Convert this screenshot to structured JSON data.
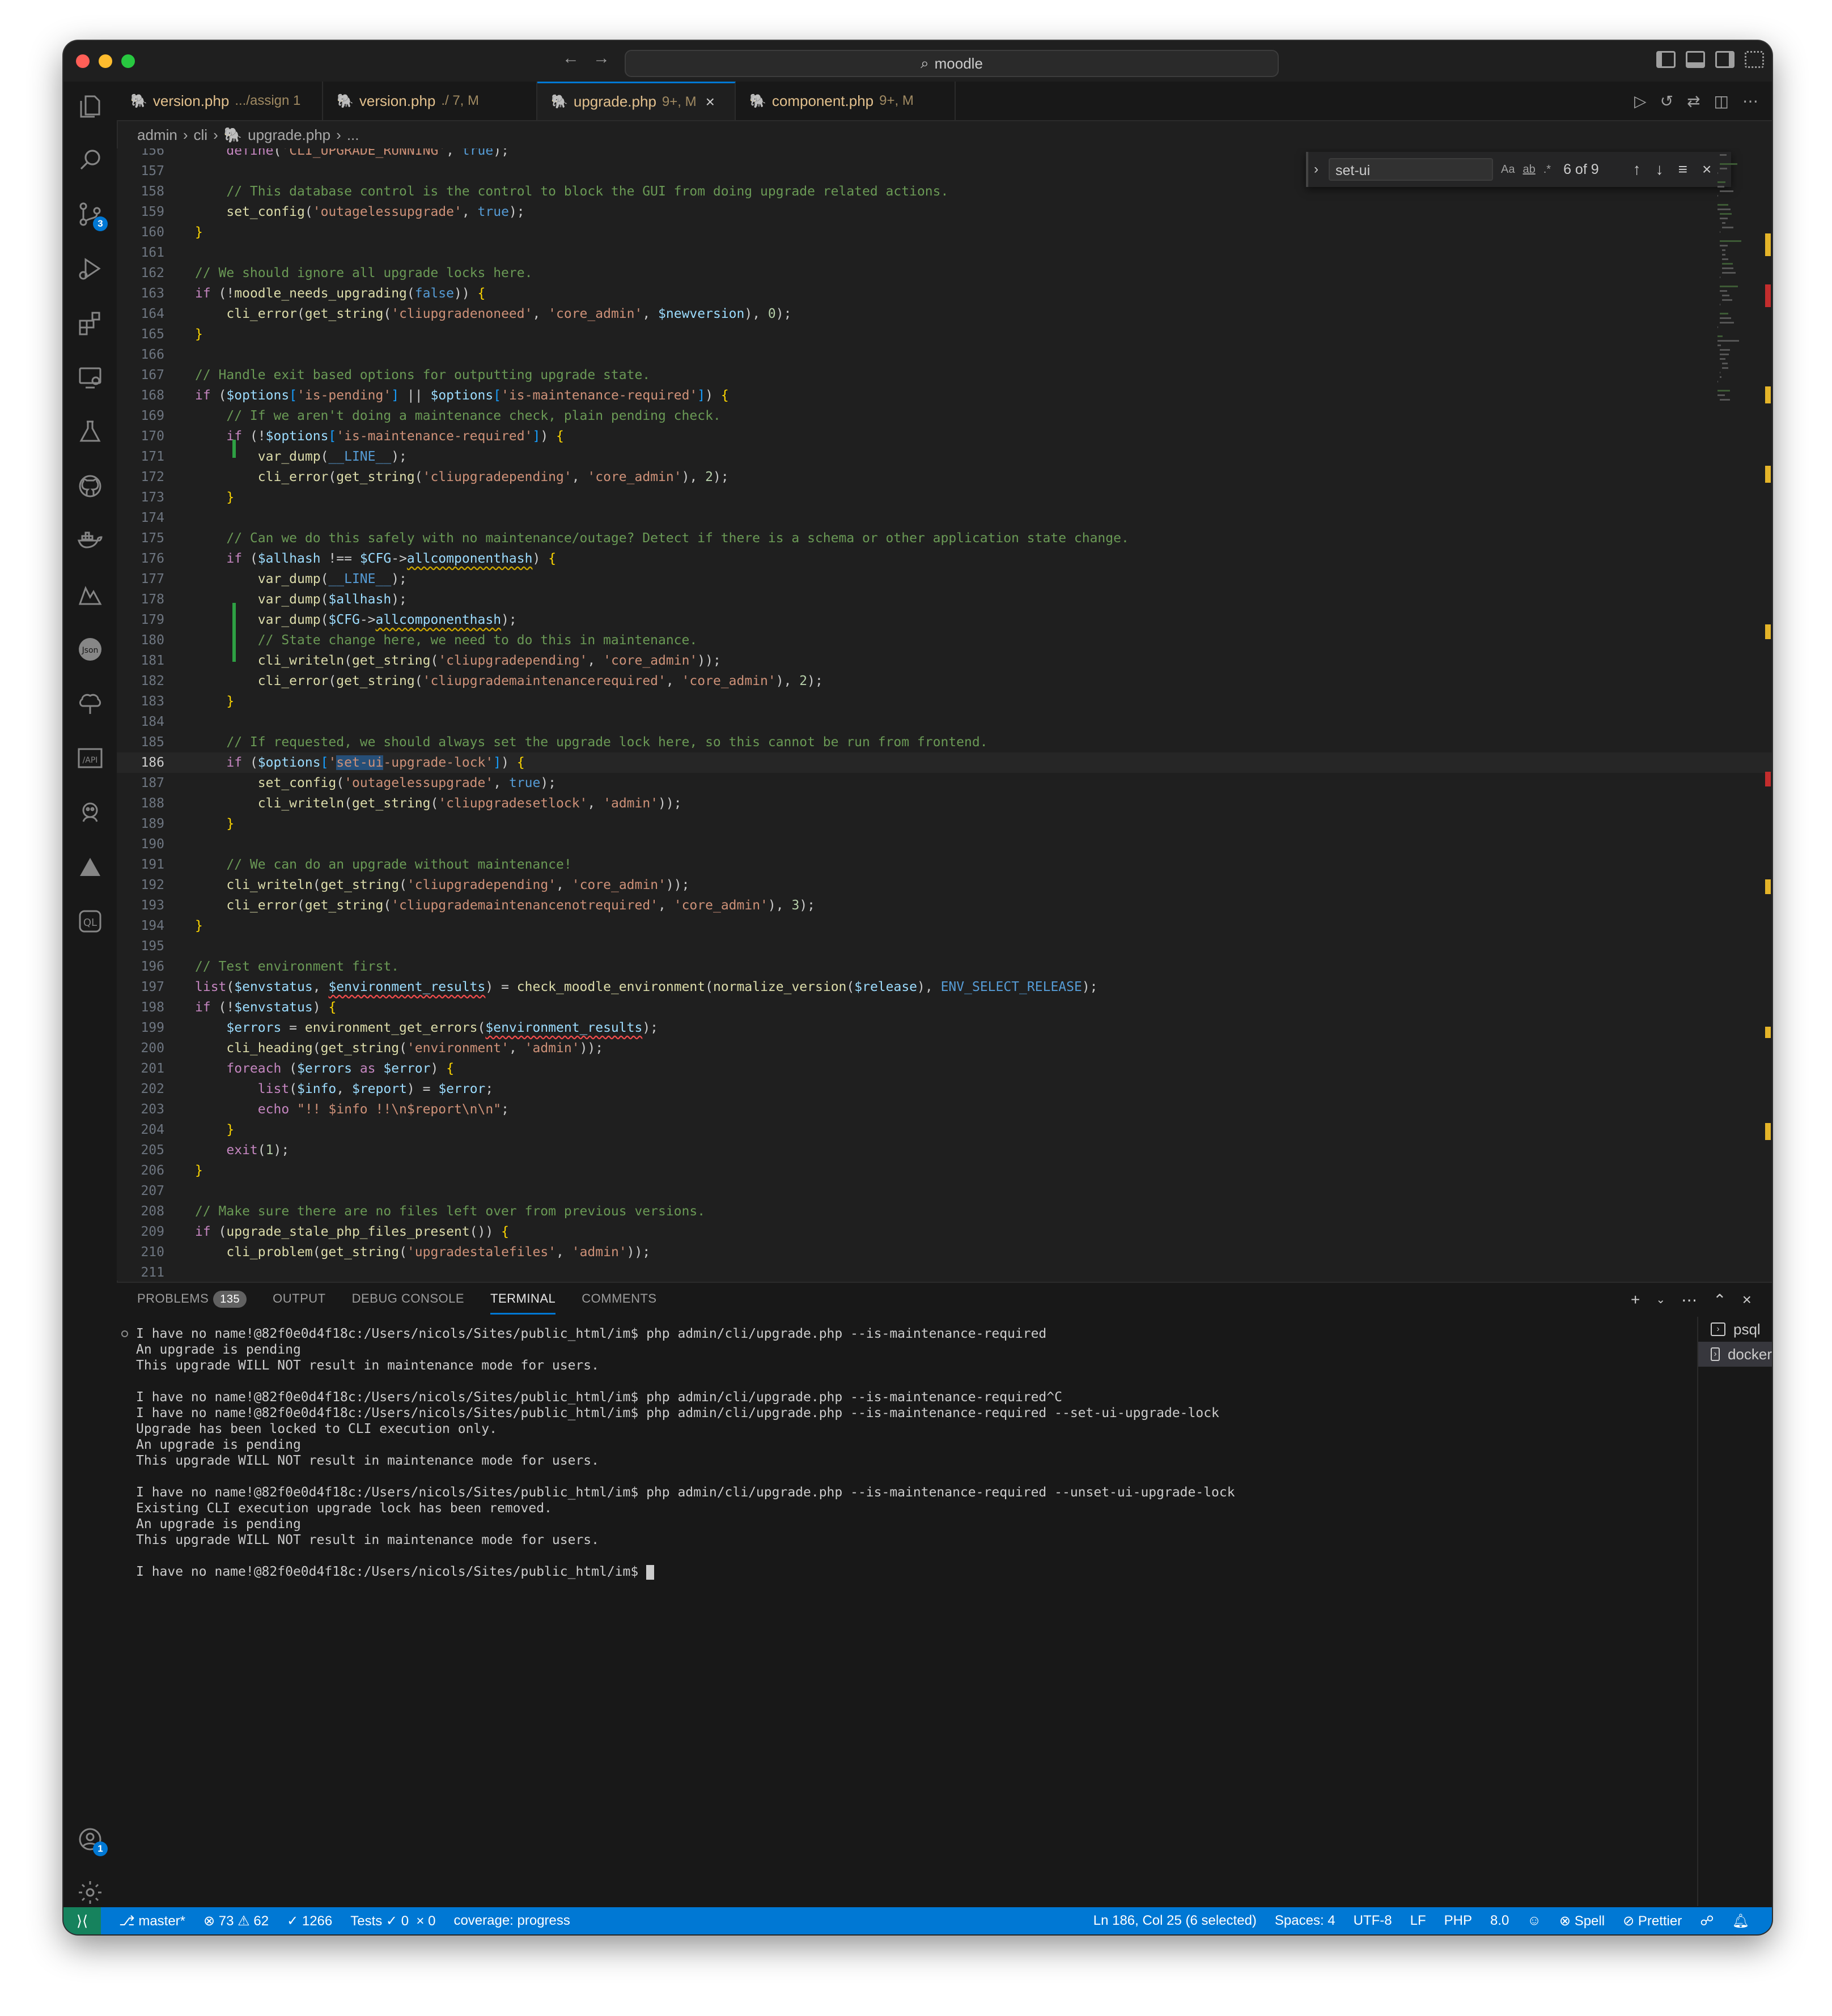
{
  "window": {
    "search": "moodle"
  },
  "tabs": [
    {
      "name": "version.php",
      "sub": ".../assign 1",
      "active": false
    },
    {
      "name": "version.php",
      "sub": "./ 7, M",
      "active": false
    },
    {
      "name": "upgrade.php",
      "sub": "9+, M",
      "active": true
    },
    {
      "name": "component.php",
      "sub": "9+, M",
      "active": false
    }
  ],
  "breadcrumb": [
    "admin",
    "cli",
    "upgrade.php",
    "..."
  ],
  "find": {
    "value": "set-ui",
    "opt_case": "Aa",
    "opt_word": "ab",
    "opt_regex": ".*",
    "count": "6 of 9"
  },
  "editor": {
    "current_line": "186",
    "lines": [
      {
        "n": "156",
        "t": "    define('CLI_UPGRADE_RUNNING', true);"
      },
      {
        "n": "157",
        "t": ""
      },
      {
        "n": "158",
        "t": "    // This database control is the control to block the GUI from doing upgrade related actions."
      },
      {
        "n": "159",
        "t": "    set_config('outagelessupgrade', true);"
      },
      {
        "n": "160",
        "t": "}"
      },
      {
        "n": "161",
        "t": ""
      },
      {
        "n": "162",
        "t": "// We should ignore all upgrade locks here."
      },
      {
        "n": "163",
        "t": "if (!moodle_needs_upgrading(false)) {"
      },
      {
        "n": "164",
        "t": "    cli_error(get_string('cliupgradenoneed', 'core_admin', $newversion), 0);"
      },
      {
        "n": "165",
        "t": "}"
      },
      {
        "n": "166",
        "t": ""
      },
      {
        "n": "167",
        "t": "// Handle exit based options for outputting upgrade state."
      },
      {
        "n": "168",
        "t": "if ($options['is-pending'] || $options['is-maintenance-required']) {"
      },
      {
        "n": "169",
        "t": "    // If we aren't doing a maintenance check, plain pending check."
      },
      {
        "n": "170",
        "t": "    if (!$options['is-maintenance-required']) {"
      },
      {
        "n": "171",
        "t": "        var_dump(__LINE__);"
      },
      {
        "n": "172",
        "t": "        cli_error(get_string('cliupgradepending', 'core_admin'), 2);"
      },
      {
        "n": "173",
        "t": "    }"
      },
      {
        "n": "174",
        "t": ""
      },
      {
        "n": "175",
        "t": "    // Can we do this safely with no maintenance/outage? Detect if there is a schema or other application state change."
      },
      {
        "n": "176",
        "t": "    if ($allhash !== $CFG->allcomponenthash) {"
      },
      {
        "n": "177",
        "t": "        var_dump(__LINE__);"
      },
      {
        "n": "178",
        "t": "        var_dump($allhash);"
      },
      {
        "n": "179",
        "t": "        var_dump($CFG->allcomponenthash);"
      },
      {
        "n": "180",
        "t": "        // State change here, we need to do this in maintenance."
      },
      {
        "n": "181",
        "t": "        cli_writeln(get_string('cliupgradepending', 'core_admin'));"
      },
      {
        "n": "182",
        "t": "        cli_error(get_string('cliupgrademaintenancerequired', 'core_admin'), 2);"
      },
      {
        "n": "183",
        "t": "    }"
      },
      {
        "n": "184",
        "t": ""
      },
      {
        "n": "185",
        "t": "    // If requested, we should always set the upgrade lock here, so this cannot be run from frontend."
      },
      {
        "n": "186",
        "t": "    if ($options['set-ui-upgrade-lock']) {"
      },
      {
        "n": "187",
        "t": "        set_config('outagelessupgrade', true);"
      },
      {
        "n": "188",
        "t": "        cli_writeln(get_string('cliupgradesetlock', 'admin'));"
      },
      {
        "n": "189",
        "t": "    }"
      },
      {
        "n": "190",
        "t": ""
      },
      {
        "n": "191",
        "t": "    // We can do an upgrade without maintenance!"
      },
      {
        "n": "192",
        "t": "    cli_writeln(get_string('cliupgradepending', 'core_admin'));"
      },
      {
        "n": "193",
        "t": "    cli_error(get_string('cliupgrademaintenancenotrequired', 'core_admin'), 3);"
      },
      {
        "n": "194",
        "t": "}"
      },
      {
        "n": "195",
        "t": ""
      },
      {
        "n": "196",
        "t": "// Test environment first."
      },
      {
        "n": "197",
        "t": "list($envstatus, $environment_results) = check_moodle_environment(normalize_version($release), ENV_SELECT_RELEASE);"
      },
      {
        "n": "198",
        "t": "if (!$envstatus) {"
      },
      {
        "n": "199",
        "t": "    $errors = environment_get_errors($environment_results);"
      },
      {
        "n": "200",
        "t": "    cli_heading(get_string('environment', 'admin'));"
      },
      {
        "n": "201",
        "t": "    foreach ($errors as $error) {"
      },
      {
        "n": "202",
        "t": "        list($info, $report) = $error;"
      },
      {
        "n": "203",
        "t": "        echo \"!! $info !!\\n$report\\n\\n\";"
      },
      {
        "n": "204",
        "t": "    }"
      },
      {
        "n": "205",
        "t": "    exit(1);"
      },
      {
        "n": "206",
        "t": "}"
      },
      {
        "n": "207",
        "t": ""
      },
      {
        "n": "208",
        "t": "// Make sure there are no files left over from previous versions."
      },
      {
        "n": "209",
        "t": "if (upgrade_stale_php_files_present()) {"
      },
      {
        "n": "210",
        "t": "    cli_problem(get_string('upgradestalefiles', 'admin'));"
      },
      {
        "n": "211",
        "t": ""
      }
    ]
  },
  "panel": {
    "tabs": [
      {
        "label": "PROBLEMS",
        "badge": "135"
      },
      {
        "label": "OUTPUT"
      },
      {
        "label": "DEBUG CONSOLE"
      },
      {
        "label": "TERMINAL",
        "active": true
      },
      {
        "label": "COMMENTS"
      }
    ],
    "terminal_lines": [
      "I have no name!@82f0e0d4f18c:/Users/nicols/Sites/public_html/im$ php admin/cli/upgrade.php --is-maintenance-required",
      "An upgrade is pending",
      "This upgrade WILL NOT result in maintenance mode for users.",
      "",
      "I have no name!@82f0e0d4f18c:/Users/nicols/Sites/public_html/im$ php admin/cli/upgrade.php --is-maintenance-required^C",
      "I have no name!@82f0e0d4f18c:/Users/nicols/Sites/public_html/im$ php admin/cli/upgrade.php --is-maintenance-required --set-ui-upgrade-lock",
      "Upgrade has been locked to CLI execution only.",
      "An upgrade is pending",
      "This upgrade WILL NOT result in maintenance mode for users.",
      "",
      "I have no name!@82f0e0d4f18c:/Users/nicols/Sites/public_html/im$ php admin/cli/upgrade.php --is-maintenance-required --unset-ui-upgrade-lock",
      "Existing CLI execution upgrade lock has been removed.",
      "An upgrade is pending",
      "This upgrade WILL NOT result in maintenance mode for users.",
      "",
      "I have no name!@82f0e0d4f18c:/Users/nicols/Sites/public_html/im$ "
    ],
    "terminals": [
      {
        "name": "psql",
        "active": false
      },
      {
        "name": "docker",
        "active": true
      }
    ]
  },
  "statusbar": {
    "branch": "master*",
    "errors": "73",
    "warnings": "62",
    "checks": "1266",
    "tests_label": "Tests",
    "tests_passed": "0",
    "tests_failed": "0",
    "coverage": "coverage: progress",
    "position": "Ln 186, Col 25 (6 selected)",
    "spaces": "Spaces: 4",
    "encoding": "UTF-8",
    "eol": "LF",
    "language": "PHP",
    "version": "8.0",
    "spell": "Spell",
    "prettier": "Prettier"
  },
  "activity_badges": {
    "scm": "3",
    "accounts": "1"
  },
  "colors": {
    "accent": "#0078d4",
    "remote": "#16825d",
    "modified_tab": "#e2c08d"
  }
}
